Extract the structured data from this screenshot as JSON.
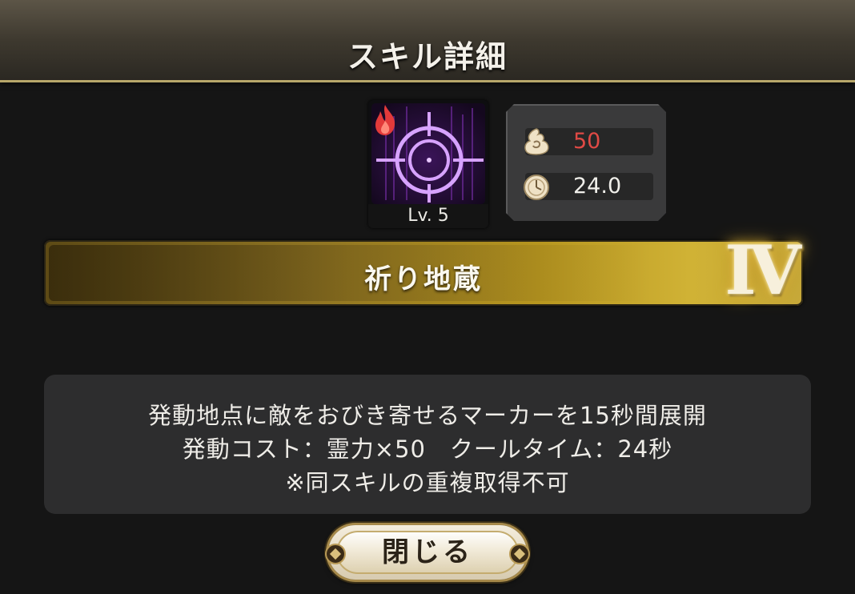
{
  "header": {
    "title": "スキル詳細"
  },
  "skill": {
    "icon": "crosshair-target-icon",
    "element_icon": "fire-icon",
    "level": "Lv. 5",
    "name": "祈り地蔵",
    "rank": "Ⅳ"
  },
  "stats": {
    "cost": {
      "icon": "spirit-flame-icon",
      "value": "50",
      "color": "#e04a45"
    },
    "cooldown": {
      "icon": "stopwatch-icon",
      "value": "24.0",
      "color": "#f0efea"
    }
  },
  "description": {
    "lines": [
      "発動地点に敵をおびき寄せるマーカーを15秒間展開",
      "発動コスト：霊力×50　クールタイム：24秒",
      "※同スキルの重複取得不可"
    ]
  },
  "close_button": {
    "label": "閉じる"
  },
  "colors": {
    "accent_gold": "#c7a93a",
    "cost_red": "#e04a45",
    "icon_purple": "#a24bd8"
  }
}
